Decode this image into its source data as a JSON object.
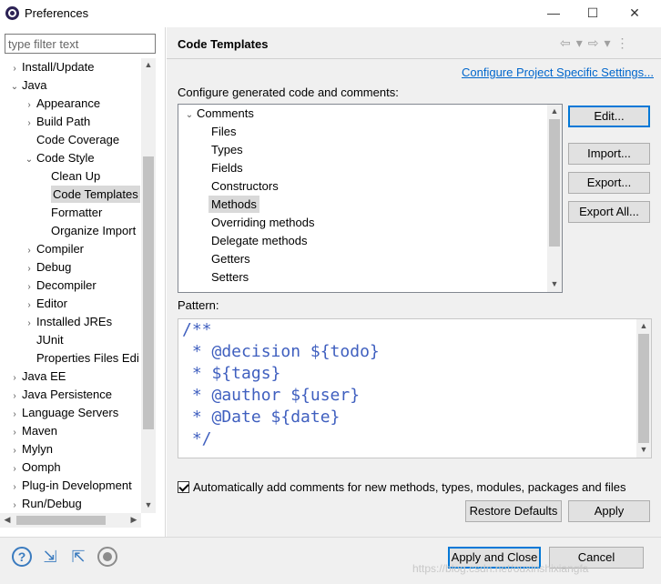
{
  "window": {
    "title": "Preferences",
    "min_glyph": "—",
    "max_glyph": "☐",
    "close_glyph": "✕"
  },
  "left": {
    "filter_placeholder": "type filter text",
    "tree": [
      {
        "label": "Install/Update",
        "level": 0,
        "arrow": "›"
      },
      {
        "label": "Java",
        "level": 0,
        "arrow": "⌄"
      },
      {
        "label": "Appearance",
        "level": 1,
        "arrow": "›"
      },
      {
        "label": "Build Path",
        "level": 1,
        "arrow": "›"
      },
      {
        "label": "Code Coverage",
        "level": 1,
        "arrow": ""
      },
      {
        "label": "Code Style",
        "level": 1,
        "arrow": "⌄"
      },
      {
        "label": "Clean Up",
        "level": 2,
        "arrow": ""
      },
      {
        "label": "Code Templates",
        "level": 2,
        "arrow": "",
        "selected": true
      },
      {
        "label": "Formatter",
        "level": 2,
        "arrow": ""
      },
      {
        "label": "Organize Import",
        "level": 2,
        "arrow": ""
      },
      {
        "label": "Compiler",
        "level": 1,
        "arrow": "›"
      },
      {
        "label": "Debug",
        "level": 1,
        "arrow": "›"
      },
      {
        "label": "Decompiler",
        "level": 1,
        "arrow": "›"
      },
      {
        "label": "Editor",
        "level": 1,
        "arrow": "›"
      },
      {
        "label": "Installed JREs",
        "level": 1,
        "arrow": "›"
      },
      {
        "label": "JUnit",
        "level": 1,
        "arrow": ""
      },
      {
        "label": "Properties Files Edi",
        "level": 1,
        "arrow": ""
      },
      {
        "label": "Java EE",
        "level": 0,
        "arrow": "›"
      },
      {
        "label": "Java Persistence",
        "level": 0,
        "arrow": "›"
      },
      {
        "label": "Language Servers",
        "level": 0,
        "arrow": "›"
      },
      {
        "label": "Maven",
        "level": 0,
        "arrow": "›"
      },
      {
        "label": "Mylyn",
        "level": 0,
        "arrow": "›"
      },
      {
        "label": "Oomph",
        "level": 0,
        "arrow": "›"
      },
      {
        "label": "Plug-in Development",
        "level": 0,
        "arrow": "›"
      },
      {
        "label": "Run/Debug",
        "level": 0,
        "arrow": "›"
      }
    ]
  },
  "main": {
    "title": "Code Templates",
    "config_link": "Configure Project Specific Settings...",
    "config_label": "Configure generated code and comments:",
    "list": [
      {
        "label": "Comments",
        "level": 0,
        "arrow": "⌄"
      },
      {
        "label": "Files",
        "level": 1
      },
      {
        "label": "Types",
        "level": 1
      },
      {
        "label": "Fields",
        "level": 1
      },
      {
        "label": "Constructors",
        "level": 1
      },
      {
        "label": "Methods",
        "level": 1,
        "selected": true
      },
      {
        "label": "Overriding methods",
        "level": 1
      },
      {
        "label": "Delegate methods",
        "level": 1
      },
      {
        "label": "Getters",
        "level": 1
      },
      {
        "label": "Setters",
        "level": 1
      }
    ],
    "buttons": {
      "edit": "Edit...",
      "import": "Import...",
      "export": "Export...",
      "export_all": "Export All..."
    },
    "pattern_label": "Pattern:",
    "pattern_text": "/**\n * @decision ${todo}\n * ${tags}\n * @author ${user}\n * @Date ${date}\n */",
    "auto_comments_label": "Automatically add comments for new methods, types, modules, packages and files",
    "auto_comments_checked": true,
    "restore_defaults": "Restore Defaults",
    "apply": "Apply"
  },
  "footer": {
    "apply_close": "Apply and Close",
    "cancel": "Cancel",
    "watermark": "https://blog.csdn.net/ouxinshixiangfa"
  },
  "colors": {
    "pattern_text": "#3f5fbf",
    "link": "#0066cc",
    "selection": "#d9d9d9"
  }
}
